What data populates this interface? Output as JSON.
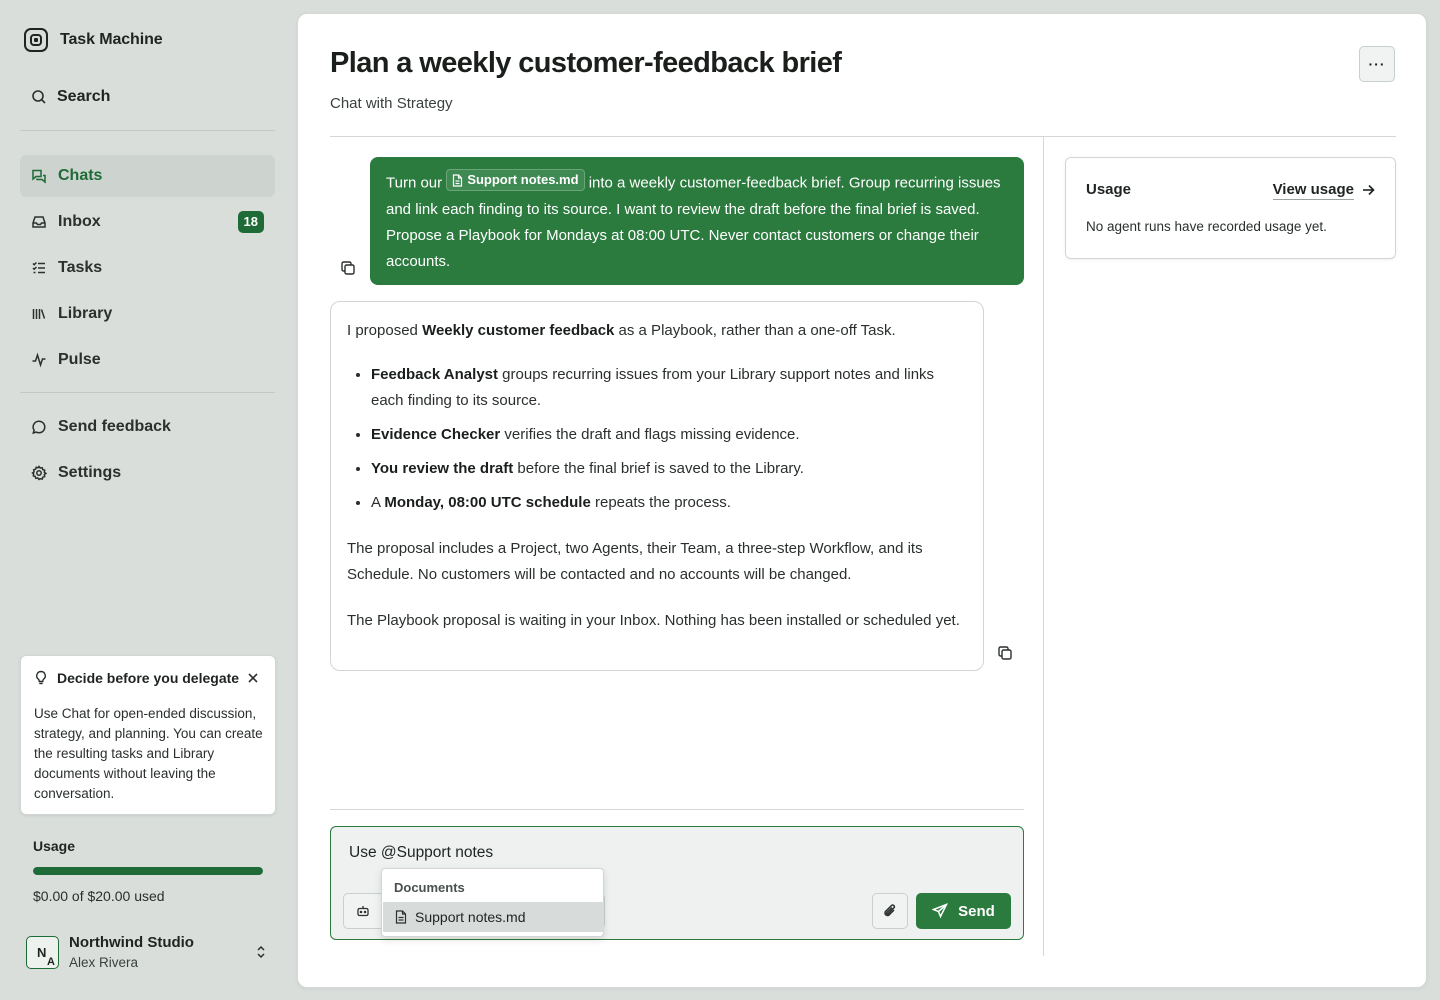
{
  "app": {
    "name": "Task Machine"
  },
  "sidebar": {
    "search_label": "Search",
    "nav": [
      {
        "label": "Chats",
        "icon": "chats-icon",
        "active": true
      },
      {
        "label": "Inbox",
        "icon": "inbox-icon",
        "badge": "18"
      },
      {
        "label": "Tasks",
        "icon": "tasks-icon"
      },
      {
        "label": "Library",
        "icon": "library-icon"
      },
      {
        "label": "Pulse",
        "icon": "pulse-icon"
      }
    ],
    "secondary": [
      {
        "label": "Send feedback",
        "icon": "chat-bubble-icon"
      },
      {
        "label": "Settings",
        "icon": "gear-icon"
      }
    ],
    "tip": {
      "title": "Decide before you delegate",
      "body": "Use Chat for open-ended discussion, strategy, and planning. You can create the resulting tasks and Library documents without leaving the conversation."
    },
    "usage": {
      "title": "Usage",
      "fraction_used": 1.0,
      "text": "$0.00 of $20.00 used"
    },
    "account": {
      "org": "Northwind Studio",
      "user": "Alex Rivera",
      "initials_top": "N",
      "initials_bottom": "A"
    }
  },
  "header": {
    "title": "Plan a weekly customer-feedback brief",
    "subtitle": "Chat with Strategy",
    "more_label": "···"
  },
  "messages": {
    "user": {
      "before_chip": "Turn our ",
      "chip": "Support notes.md",
      "after_chip": " into a weekly customer-feedback brief. Group recurring issues and link each finding to its source. I want to review the draft before the final brief is saved. Propose a Playbook for Mondays at 08:00 UTC. Never contact customers or change their accounts."
    },
    "assistant": {
      "intro_a": "I proposed ",
      "intro_b": "Weekly customer feedback",
      "intro_c": " as a Playbook, rather than a one-off Task.",
      "bullets": [
        {
          "bold": "Feedback Analyst",
          "text": " groups recurring issues from your Library support notes and links each finding to its source."
        },
        {
          "bold": "Evidence Checker",
          "text": " verifies the draft and flags missing evidence."
        },
        {
          "bold": "You review the draft",
          "text": " before the final brief is saved to the Library."
        },
        {
          "pre": "A ",
          "bold": "Monday, 08:00 UTC schedule",
          "text": " repeats the process."
        }
      ],
      "para2": "The proposal includes a Project, two Agents, their Team, a three-step Workflow, and its Schedule. No customers will be contacted and no accounts will be changed.",
      "para3": "The Playbook proposal is waiting in your Inbox. Nothing has been installed or scheduled yet."
    }
  },
  "composer": {
    "value": "Use @Support notes",
    "send_label": "Send",
    "mention_popup": {
      "heading": "Documents",
      "item": "Support notes.md"
    }
  },
  "usage_card": {
    "title": "Usage",
    "link": "View usage",
    "empty": "No agent runs have recorded usage yet."
  },
  "colors": {
    "accent": "#2b7a3e",
    "sidebar_bg": "#d9dedb",
    "active_nav": "#1e6b37"
  }
}
